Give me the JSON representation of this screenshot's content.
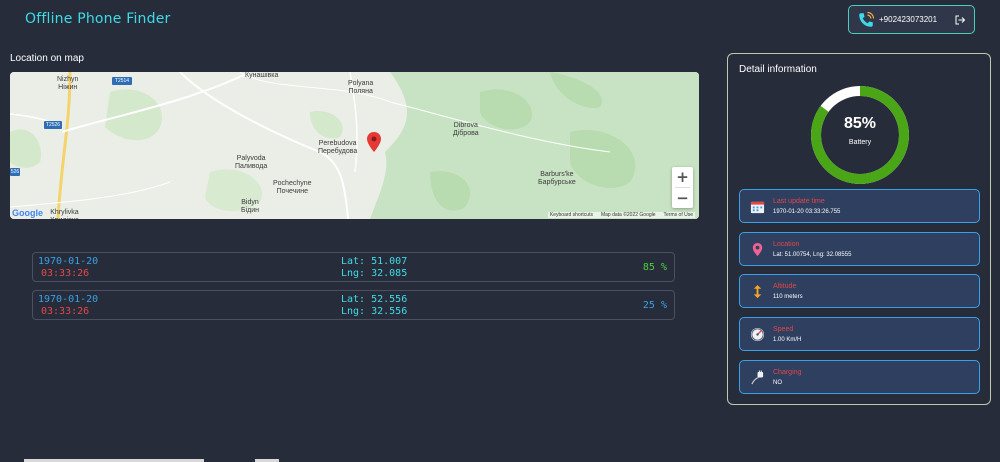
{
  "header": {
    "title": "Offline Phone Finder",
    "phone_number": "+902423073201",
    "phone_icon": "phone-ringing-icon",
    "logout_icon": "logout-icon"
  },
  "map": {
    "title": "Location on map",
    "places": [
      {
        "id": "nizhyn",
        "text": "Nizhyn\nНіжин"
      },
      {
        "id": "kunashivka",
        "text": "Кунашівка"
      },
      {
        "id": "polyana",
        "text": "Polyana\nПоляна"
      },
      {
        "id": "dibrova",
        "text": "Dibrova\nДіброва"
      },
      {
        "id": "perebudova",
        "text": "Perebudova\nПеребудова"
      },
      {
        "id": "palyvoda",
        "text": "Palyvoda\nПаливода"
      },
      {
        "id": "pochechyne",
        "text": "Pochechyne\nПочечине"
      },
      {
        "id": "bidyn",
        "text": "Bidyn\nБідин"
      },
      {
        "id": "barburske",
        "text": "Barburs'ke\nБарбурське"
      },
      {
        "id": "khrylivka",
        "text": "Khrylivka\nХрилівка"
      }
    ],
    "road_labels": [
      "T2514",
      "T2526",
      "526"
    ],
    "zoom_in": "+",
    "zoom_out": "−",
    "google": "Google",
    "attribution": {
      "shortcuts": "Keyboard shortcuts",
      "data": "Map data ©2022 Google",
      "terms": "Terms of Use"
    }
  },
  "records": [
    {
      "date": "1970-01-20",
      "time": "03:33:26",
      "lat": "Lat: 51.007",
      "lng": "Lng: 32.085",
      "percent": "85 %",
      "percent_color": "#4cd137"
    },
    {
      "date": "1970-01-20",
      "time": "03:33:26",
      "lat": "Lat: 52.556",
      "lng": "Lng: 32.556",
      "percent": "25 %",
      "percent_color": "#3aa0e6"
    }
  ],
  "detail": {
    "title": "Detail information",
    "battery": {
      "value": "85%",
      "label": "Battery",
      "fraction": 0.85,
      "color": "#4aa616"
    },
    "cards": [
      {
        "icon": "calendar-icon",
        "label": "Last update time",
        "value": "1970-01-20 03:33:26.755"
      },
      {
        "icon": "map-pin-icon",
        "label": "Location",
        "value": "Lat: 51.00754, Lng: 32.08555"
      },
      {
        "icon": "altitude-arrows-icon",
        "label": "Altitude",
        "value": "110 meters"
      },
      {
        "icon": "speedometer-icon",
        "label": "Speed",
        "value": "1.00 Km/H"
      },
      {
        "icon": "charging-plug-icon",
        "label": "Charging",
        "value": "NO"
      }
    ]
  }
}
